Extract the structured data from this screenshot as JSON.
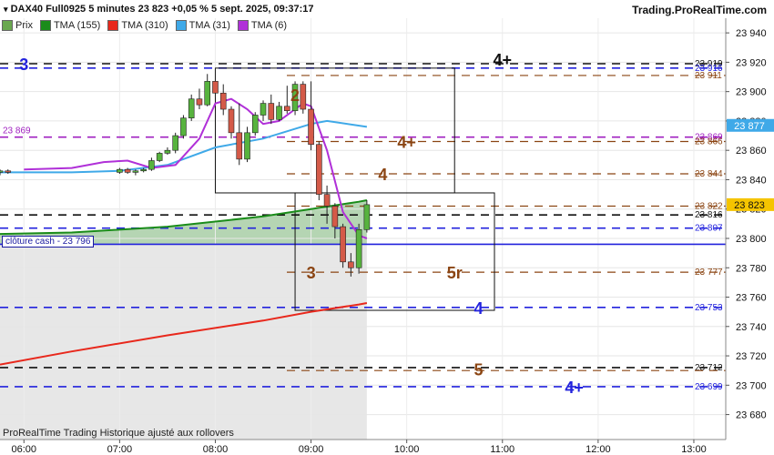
{
  "header": {
    "title": "DAX40 Full0925 5 minutes 23 823 +0,05 % 5 sept. 2025, 09:37:17",
    "brand": "Trading.ProRealTime.com"
  },
  "legend": [
    {
      "label": "Prix",
      "color": "#6aa84f"
    },
    {
      "label": "TMA (155)",
      "color": "#1a8c1a"
    },
    {
      "label": "TMA (310)",
      "color": "#e8281c"
    },
    {
      "label": "TMA (31)",
      "color": "#3fa9e8"
    },
    {
      "label": "TMA (6)",
      "color": "#b030d8"
    }
  ],
  "footnote": "ProRealTime Trading  Historique ajusté aux rollovers",
  "close_label": "clôture cash -  23 796",
  "left_level_label": "23 869",
  "chart_data": {
    "type": "candlestick",
    "instrument": "DAX40 Full0925",
    "timeframe": "5 minutes",
    "last_price": 23823,
    "change_pct": "+0,05 %",
    "timestamp": "5 sept. 2025, 09:37:17",
    "ylim": [
      23663,
      23950
    ],
    "xlim": [
      "05:45",
      "13:20"
    ],
    "y_ticks": [
      "23 680",
      "23 700",
      "23 720",
      "23 740",
      "23 760",
      "23 780",
      "23 800",
      "23 820",
      "23 840",
      "23 860",
      "23 880",
      "23 900",
      "23 920",
      "23 940"
    ],
    "x_ticks": [
      "06:00",
      "07:00",
      "08:00",
      "09:00",
      "10:00",
      "11:00",
      "12:00",
      "13:00"
    ],
    "candles": [
      {
        "t": "05:45",
        "o": 23845,
        "h": 23847,
        "l": 23843,
        "c": 23846
      },
      {
        "t": "05:50",
        "o": 23846,
        "h": 23847,
        "l": 23844,
        "c": 23845
      },
      {
        "t": "07:00",
        "o": 23845,
        "h": 23848,
        "l": 23844,
        "c": 23847
      },
      {
        "t": "07:05",
        "o": 23847,
        "h": 23848,
        "l": 23844,
        "c": 23845
      },
      {
        "t": "07:10",
        "o": 23845,
        "h": 23847,
        "l": 23843,
        "c": 23846
      },
      {
        "t": "07:15",
        "o": 23846,
        "h": 23848,
        "l": 23845,
        "c": 23847
      },
      {
        "t": "07:20",
        "o": 23847,
        "h": 23855,
        "l": 23846,
        "c": 23853
      },
      {
        "t": "07:25",
        "o": 23853,
        "h": 23859,
        "l": 23852,
        "c": 23858
      },
      {
        "t": "07:30",
        "o": 23858,
        "h": 23862,
        "l": 23857,
        "c": 23860
      },
      {
        "t": "07:35",
        "o": 23860,
        "h": 23872,
        "l": 23858,
        "c": 23870
      },
      {
        "t": "07:40",
        "o": 23870,
        "h": 23884,
        "l": 23868,
        "c": 23882
      },
      {
        "t": "07:45",
        "o": 23882,
        "h": 23898,
        "l": 23880,
        "c": 23895
      },
      {
        "t": "07:50",
        "o": 23895,
        "h": 23902,
        "l": 23888,
        "c": 23891
      },
      {
        "t": "07:55",
        "o": 23891,
        "h": 23912,
        "l": 23890,
        "c": 23907
      },
      {
        "t": "08:00",
        "o": 23907,
        "h": 23916,
        "l": 23896,
        "c": 23899
      },
      {
        "t": "08:05",
        "o": 23899,
        "h": 23905,
        "l": 23884,
        "c": 23888
      },
      {
        "t": "08:10",
        "o": 23888,
        "h": 23890,
        "l": 23868,
        "c": 23872
      },
      {
        "t": "08:15",
        "o": 23872,
        "h": 23892,
        "l": 23850,
        "c": 23854
      },
      {
        "t": "08:20",
        "o": 23854,
        "h": 23876,
        "l": 23852,
        "c": 23872
      },
      {
        "t": "08:25",
        "o": 23872,
        "h": 23886,
        "l": 23870,
        "c": 23884
      },
      {
        "t": "08:30",
        "o": 23884,
        "h": 23894,
        "l": 23880,
        "c": 23892
      },
      {
        "t": "08:35",
        "o": 23892,
        "h": 23898,
        "l": 23878,
        "c": 23881
      },
      {
        "t": "08:40",
        "o": 23881,
        "h": 23893,
        "l": 23880,
        "c": 23890
      },
      {
        "t": "08:45",
        "o": 23890,
        "h": 23904,
        "l": 23885,
        "c": 23887
      },
      {
        "t": "08:50",
        "o": 23887,
        "h": 23907,
        "l": 23884,
        "c": 23905
      },
      {
        "t": "08:55",
        "o": 23905,
        "h": 23907,
        "l": 23885,
        "c": 23888
      },
      {
        "t": "09:00",
        "o": 23888,
        "h": 23907,
        "l": 23860,
        "c": 23864
      },
      {
        "t": "09:05",
        "o": 23864,
        "h": 23866,
        "l": 23826,
        "c": 23830
      },
      {
        "t": "09:10",
        "o": 23830,
        "h": 23836,
        "l": 23810,
        "c": 23822
      },
      {
        "t": "09:15",
        "o": 23822,
        "h": 23824,
        "l": 23800,
        "c": 23808
      },
      {
        "t": "09:20",
        "o": 23808,
        "h": 23810,
        "l": 23780,
        "c": 23784
      },
      {
        "t": "09:25",
        "o": 23784,
        "h": 23790,
        "l": 23774,
        "c": 23780
      },
      {
        "t": "09:30",
        "o": 23780,
        "h": 23810,
        "l": 23776,
        "c": 23806
      },
      {
        "t": "09:35",
        "o": 23806,
        "h": 23826,
        "l": 23804,
        "c": 23823
      }
    ],
    "series": [
      {
        "name": "TMA (155)",
        "color": "#1a8c1a",
        "x": [
          "05:45",
          "06:30",
          "07:30",
          "08:30",
          "09:00",
          "09:30",
          "09:35"
        ],
        "y": [
          23803,
          23804,
          23808,
          23815,
          23820,
          23825,
          23826
        ]
      },
      {
        "name": "TMA (310)",
        "color": "#e8281c",
        "x": [
          "05:45",
          "06:30",
          "07:30",
          "08:30",
          "09:00",
          "09:30",
          "09:35"
        ],
        "y": [
          23714,
          23723,
          23734,
          23744,
          23750,
          23755,
          23756
        ]
      },
      {
        "name": "TMA (31)",
        "color": "#3fa9e8",
        "x": [
          "05:45",
          "06:30",
          "07:00",
          "07:30",
          "08:00",
          "08:30",
          "09:00",
          "09:10",
          "09:35"
        ],
        "y": [
          23845,
          23845,
          23846,
          23850,
          23862,
          23868,
          23878,
          23880,
          23876
        ]
      },
      {
        "name": "TMA (6)",
        "color": "#b030d8",
        "x": [
          "06:00",
          "06:30",
          "06:50",
          "07:05",
          "07:20",
          "07:35",
          "07:50",
          "08:00",
          "08:10",
          "08:20",
          "08:30",
          "08:40",
          "08:50",
          "08:55",
          "09:00",
          "09:10",
          "09:20",
          "09:30",
          "09:35"
        ],
        "y": [
          23847,
          23848,
          23852,
          23853,
          23848,
          23850,
          23868,
          23892,
          23895,
          23888,
          23878,
          23880,
          23888,
          23892,
          23890,
          23860,
          23818,
          23802,
          23800
        ]
      }
    ],
    "levels": [
      {
        "y": 23919,
        "label": "23 919",
        "color": "#111",
        "style": "dash"
      },
      {
        "y": 23916,
        "label": "23 916",
        "color": "#2222dd",
        "style": "dash"
      },
      {
        "y": 23911,
        "label": "23 911",
        "color": "#8b4513",
        "style": "dash"
      },
      {
        "y": 23869,
        "label": "23 869",
        "color": "#a020c0",
        "style": "dash"
      },
      {
        "y": 23866,
        "label": "23 866",
        "color": "#8b4513",
        "style": "dash"
      },
      {
        "y": 23844,
        "label": "23 844",
        "color": "#8b4513",
        "style": "dash"
      },
      {
        "y": 23822,
        "label": "23 822",
        "color": "#8b4513",
        "style": "dash"
      },
      {
        "y": 23816,
        "label": "23 816",
        "color": "#111",
        "style": "dash"
      },
      {
        "y": 23807,
        "label": "23 807",
        "color": "#2222dd",
        "style": "dash"
      },
      {
        "y": 23796,
        "label": "",
        "color": "#2222dd",
        "style": "solid"
      },
      {
        "y": 23777,
        "label": "23 777",
        "color": "#8b4513",
        "style": "dash"
      },
      {
        "y": 23753,
        "label": "23 753",
        "color": "#2222dd",
        "style": "dash"
      },
      {
        "y": 23712,
        "label": "23 712",
        "color": "#111",
        "style": "dash"
      },
      {
        "y": 23710,
        "label": "",
        "color": "#8b4513",
        "style": "dash"
      },
      {
        "y": 23699,
        "label": "23 699",
        "color": "#2222dd",
        "style": "dash"
      }
    ],
    "annotations": [
      {
        "text": "3",
        "t": "06:00",
        "y": 23919,
        "color": "#2222dd"
      },
      {
        "text": "4+",
        "t": "11:00",
        "y": 23922,
        "color": "#111"
      },
      {
        "text": "2",
        "t": "08:50",
        "y": 23898,
        "color": "#8b4513"
      },
      {
        "text": "4+",
        "t": "10:00",
        "y": 23866,
        "color": "#8b4513"
      },
      {
        "text": "4",
        "t": "09:45",
        "y": 23844,
        "color": "#8b4513"
      },
      {
        "text": "3",
        "t": "09:00",
        "y": 23777,
        "color": "#8b4513"
      },
      {
        "text": "5r",
        "t": "10:30",
        "y": 23777,
        "color": "#8b4513"
      },
      {
        "text": "4",
        "t": "10:45",
        "y": 23753,
        "color": "#2222dd"
      },
      {
        "text": "5",
        "t": "10:45",
        "y": 23711,
        "color": "#8b4513"
      },
      {
        "text": "4+",
        "t": "11:45",
        "y": 23699,
        "color": "#2222dd"
      }
    ],
    "last_price_label": "23 823",
    "tma31_label": "23 877",
    "grid": true
  }
}
